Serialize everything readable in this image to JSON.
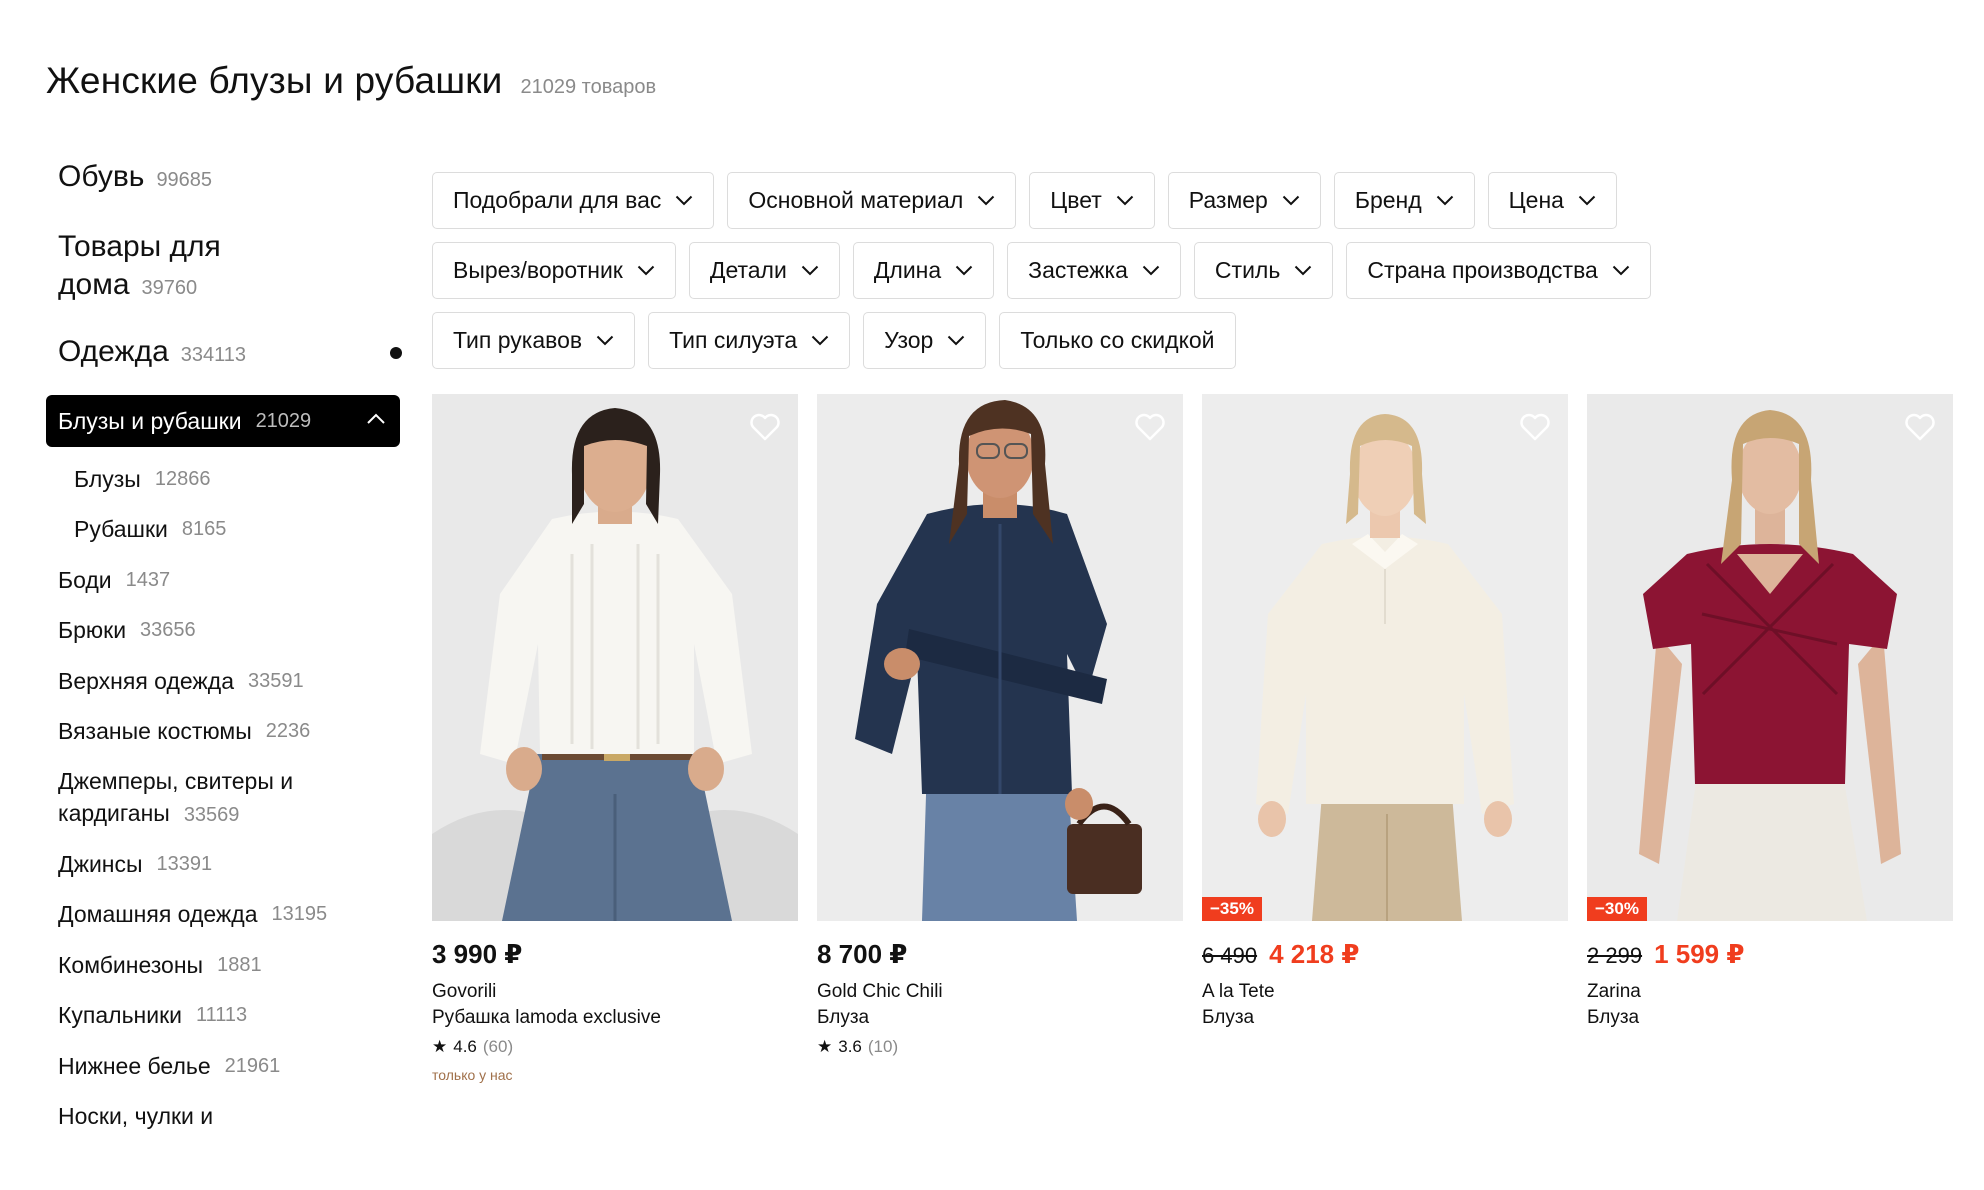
{
  "header": {
    "title": "Женские блузы и рубашки",
    "count": "21029 товаров"
  },
  "sidebar": {
    "top": [
      {
        "label": "Обувь",
        "count": "99685"
      },
      {
        "label": "Товары для дома",
        "count": "39760"
      },
      {
        "label": "Одежда",
        "count": "334113"
      }
    ],
    "active": {
      "label": "Блузы и рубашки",
      "count": "21029"
    },
    "items": [
      {
        "label": "Блузы",
        "count": "12866"
      },
      {
        "label": "Рубашки",
        "count": "8165"
      },
      {
        "label": "Боди",
        "count": "1437"
      },
      {
        "label": "Брюки",
        "count": "33656"
      },
      {
        "label": "Верхняя одежда",
        "count": "33591"
      },
      {
        "label": "Вязаные костюмы",
        "count": "2236"
      },
      {
        "label": "Джемперы, свитеры и кардиганы",
        "count": "33569"
      },
      {
        "label": "Джинсы",
        "count": "13391"
      },
      {
        "label": "Домашняя одежда",
        "count": "13195"
      },
      {
        "label": "Комбинезоны",
        "count": "1881"
      },
      {
        "label": "Купальники",
        "count": "11113"
      },
      {
        "label": "Нижнее белье",
        "count": "21961"
      },
      {
        "label": "Носки, чулки и",
        "count": ""
      }
    ]
  },
  "filters": {
    "row1": [
      "Подобрали для вас",
      "Основной материал",
      "Цвет",
      "Размер",
      "Бренд",
      "Цена"
    ],
    "row2": [
      "Вырез/воротник",
      "Детали",
      "Длина",
      "Застежка",
      "Стиль",
      "Страна производства"
    ],
    "row3": [
      "Тип рукавов",
      "Тип силуэта",
      "Узор"
    ],
    "discount_only": "Только со скидкой"
  },
  "products": [
    {
      "price": "3 990 ₽",
      "old_price": "",
      "discount": "",
      "brand": "Govorili",
      "type": "Рубашка lamoda exclusive",
      "rating": "4.6",
      "reviews": "(60)",
      "tag": "только у нас"
    },
    {
      "price": "8 700 ₽",
      "old_price": "",
      "discount": "",
      "brand": "Gold Chic Chili",
      "type": "Блуза",
      "rating": "3.6",
      "reviews": "(10)",
      "tag": ""
    },
    {
      "price": "4 218 ₽",
      "old_price": "6 490",
      "discount": "−35%",
      "brand": "A la Tete",
      "type": "Блуза",
      "rating": "",
      "reviews": "",
      "tag": ""
    },
    {
      "price": "1 599 ₽",
      "old_price": "2 299",
      "discount": "−30%",
      "brand": "Zarina",
      "type": "Блуза",
      "rating": "",
      "reviews": "",
      "tag": ""
    }
  ],
  "colors": {
    "accent_sale": "#f03d1e",
    "active_bg": "#000000",
    "muted": "#8a8a8a",
    "tag": "#a0704a"
  }
}
